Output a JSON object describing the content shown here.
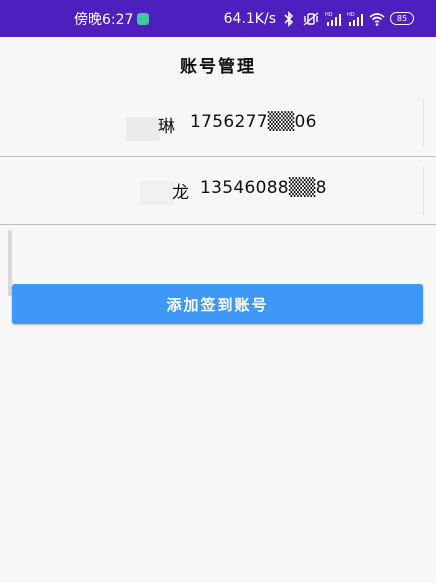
{
  "status_bar": {
    "time": "傍晚6:27",
    "network_speed": "64.1K/s",
    "battery_level": "85",
    "icons": [
      "bluetooth-icon",
      "vibrate-mute-icon",
      "signal-hd-icon",
      "signal-hd-2-icon",
      "wifi-icon",
      "battery-icon"
    ]
  },
  "header": {
    "title": "账号管理"
  },
  "accounts": [
    {
      "name": "琳",
      "phone": "1756277▒▒06"
    },
    {
      "name": "龙",
      "phone": "13546088▒▒8"
    }
  ],
  "actions": {
    "add_label": "添加签到账号"
  },
  "colors": {
    "status_bar": "#4f1ebf",
    "button": "#3e98f7",
    "background": "#f7f7f7",
    "divider": "#bdbdbd"
  }
}
